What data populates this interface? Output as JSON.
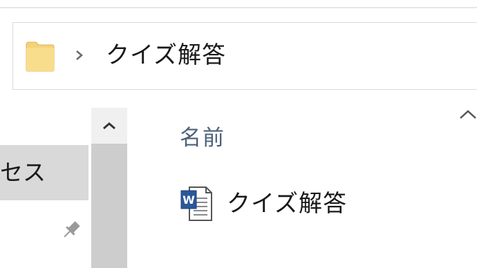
{
  "address_bar": {
    "folder_icon": "folder-icon",
    "separator_icon": "chevron-right-icon",
    "path_segment": "クイズ解答"
  },
  "nav_pane": {
    "selected_item_label": "セス",
    "pin_icon": "pin-icon",
    "scroll_up_icon": "chevron-up-icon"
  },
  "file_list": {
    "column_header": "名前",
    "sort_icon": "chevron-up-icon",
    "files": [
      {
        "name": "クイズ解答",
        "icon": "word-document-icon"
      }
    ]
  },
  "colors": {
    "folder": "#f4d27a",
    "selection": "#d9d9d9",
    "header_text": "#4c607a",
    "word_blue": "#2b579a"
  }
}
